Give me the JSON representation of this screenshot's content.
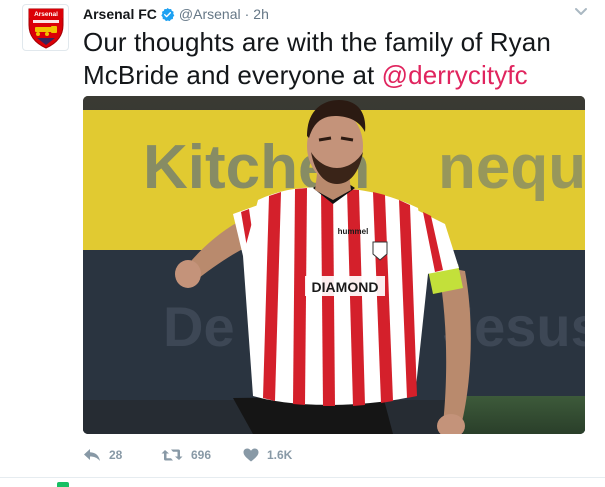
{
  "tweet": {
    "author_name": "Arsenal FC",
    "handle": "@Arsenal",
    "separator": "·",
    "time": "2h",
    "text_main": "Our thoughts are with the family of Ryan McBride and everyone at ",
    "mention": "@derrycityfc",
    "avatar_icon": "arsenal-crest-icon",
    "avatar_text": "Arsenal",
    "verified_icon": "verified-badge-icon",
    "menu_icon": "chevron-down-icon",
    "media": {
      "description_icon": "player-photo",
      "sponsor_text": "DIAMOND",
      "kit_text": "hummel"
    }
  },
  "actions": {
    "reply": {
      "icon": "reply-icon",
      "count": "28"
    },
    "retweet": {
      "icon": "retweet-icon",
      "count": "696"
    },
    "like": {
      "icon": "heart-icon",
      "count": "1.6K"
    }
  },
  "colors": {
    "text": "#14171a",
    "muted": "#657786",
    "mention": "#e0245e",
    "verified": "#1da1f2",
    "action_gray": "#8899a6",
    "arsenal_red": "#db0007"
  }
}
